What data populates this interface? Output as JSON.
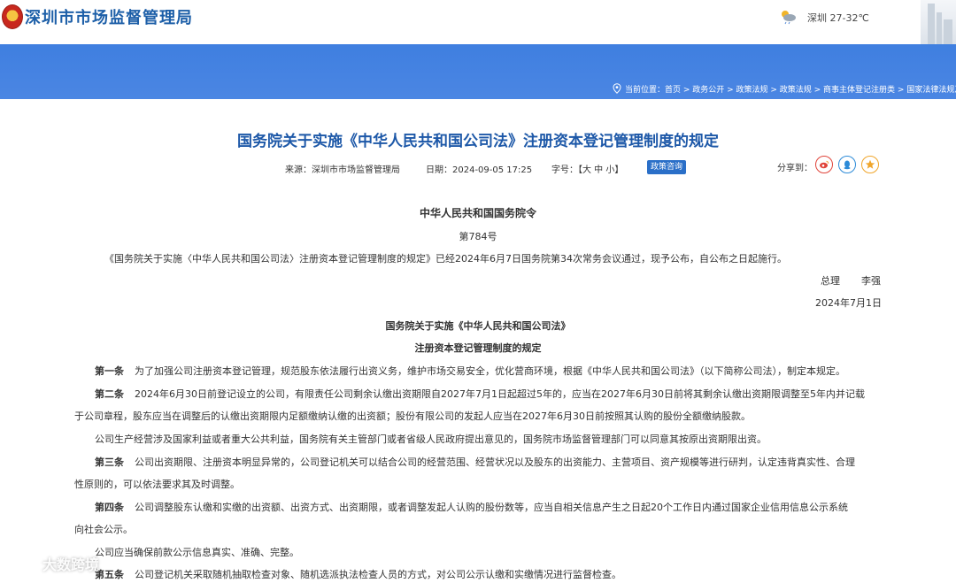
{
  "header": {
    "site_name": "深圳市市场监督管理局",
    "weather": "深圳 27-32℃"
  },
  "breadcrumb": "当前位置：首页 > 政务公开 > 政策法规 > 政策法规 > 商事主体登记注册类 > 国家法律法规及规章",
  "article": {
    "title": "国务院关于实施《中华人民共和国公司法》注册资本登记管理制度的规定",
    "source": "来源：深圳市市场监督管理局",
    "date": "日期：2024-09-05 17:25",
    "font_size_label": "字号：【大  中  小】",
    "badge": "政策咨询",
    "share_label": "分享到：",
    "order_title": "中华人民共和国国务院令",
    "order_number": "第784号",
    "intro": "《国务院关于实施〈中华人民共和国公司法〉注册资本登记管理制度的规定》已经2024年6月7日国务院第34次常务会议通过，现予公布，自公布之日起施行。",
    "premier_title": "总理",
    "premier_name": "李强",
    "sign_date": "2024年7月1日",
    "reg_title_1": "国务院关于实施《中华人民共和国公司法》",
    "reg_title_2": "注册资本登记管理制度的规定",
    "art1_label": "第一条",
    "art1_text": "为了加强公司注册资本登记管理，规范股东依法履行出资义务，维护市场交易安全，优化营商环境，根据《中华人民共和国公司法》（以下简称公司法），制定本规定。",
    "art2_label": "第二条",
    "art2_text_1": "2024年6月30日前登记设立的公司，有限责任公司剩余认缴出资期限自2027年7月1日起超过5年的，应当在2027年6月30日前将其剩余认缴出资期限调整至5年内并记载",
    "art2_text_2": "于公司章程，股东应当在调整后的认缴出资期限内足额缴纳认缴的出资额；股份有限公司的发起人应当在2027年6月30日前按照其认购的股份全额缴纳股款。",
    "art2_text_3": "公司生产经营涉及国家利益或者重大公共利益，国务院有关主管部门或者省级人民政府提出意见的，国务院市场监督管理部门可以同意其按原出资期限出资。",
    "art3_label": "第三条",
    "art3_text_1": "公司出资期限、注册资本明显异常的，公司登记机关可以结合公司的经营范围、经营状况以及股东的出资能力、主营项目、资产规模等进行研判，认定违背真实性、合理",
    "art3_text_2": "性原则的，可以依法要求其及时调整。",
    "art4_label": "第四条",
    "art4_text_1": "公司调整股东认缴和实缴的出资额、出资方式、出资期限，或者调整发起人认购的股份数等，应当自相关信息产生之日起20个工作日内通过国家企业信用信息公示系统",
    "art4_text_2": "向社会公示。",
    "art4_text_3": "公司应当确保前款公示信息真实、准确、完整。",
    "art5_label": "第五条",
    "art5_text": "公司登记机关采取随机抽取检查对象、随机选派执法检查人员的方式，对公司公示认缴和实缴情况进行监督检查。"
  },
  "watermark": "大数跨境",
  "colors": {
    "banner": "#4680e2",
    "title": "#1d58a8",
    "badge": "#2a6fc8"
  },
  "icons": [
    "police-emblem-icon",
    "weather-cloud-icon",
    "location-pin-icon",
    "weibo-icon",
    "qq-icon",
    "qzone-star-icon",
    "watermark-logo-icon"
  ]
}
